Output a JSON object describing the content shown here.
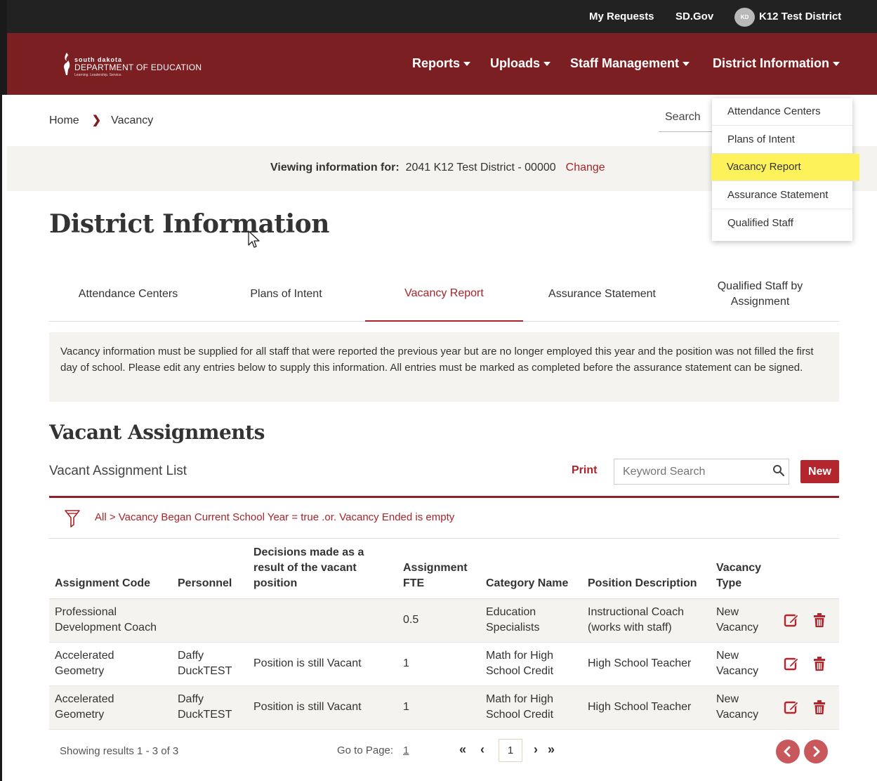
{
  "topbar": {
    "my_requests": "My Requests",
    "sd_gov": "SD.Gov",
    "avatar_initials": "KD",
    "user": "K12 Test District"
  },
  "logo": {
    "line1": "south dakota",
    "line2": "DEPARTMENT OF EDUCATION",
    "line3": "Learning. Leadership. Service."
  },
  "nav": {
    "items": [
      {
        "label": "Reports"
      },
      {
        "label": "Uploads"
      },
      {
        "label": "Staff Management"
      },
      {
        "label": "District Information"
      }
    ]
  },
  "breadcrumb": {
    "home": "Home",
    "current": "Vacancy"
  },
  "search_label": "Search",
  "viewing": {
    "label": "Viewing information for:",
    "value": "2041 K12 Test District - 00000",
    "change": "Change"
  },
  "dropdown": {
    "items": [
      {
        "label": "Attendance Centers"
      },
      {
        "label": "Plans of Intent"
      },
      {
        "label": "Vacancy Report"
      },
      {
        "label": "Assurance Statement"
      },
      {
        "label": "Qualified Staff"
      }
    ],
    "highlight_color": "#fef25b"
  },
  "page_title": "District Information",
  "tabs": [
    {
      "label": "Attendance Centers"
    },
    {
      "label": "Plans of Intent"
    },
    {
      "label": "Vacancy Report"
    },
    {
      "label": "Assurance Statement"
    },
    {
      "label": "Qualified Staff by Assignment"
    }
  ],
  "notice": "Vacancy information must be supplied for all staff that were reported the previous year but are no longer employed this year and the position was not filled the first day of school. Please edit any entries below to supply this information. All entries must be marked as completed before the assurance statement can be signed.",
  "section_title": "Vacant Assignments",
  "list": {
    "title": "Vacant Assignment List",
    "print": "Print",
    "keyword_placeholder": "Keyword Search",
    "new_button": "New"
  },
  "filter_text": "All > Vacancy Began Current School Year = true .or. Vacancy Ended is empty",
  "table": {
    "columns": [
      "Assignment Code",
      "Personnel",
      "Decisions made as a result of the vacant position",
      "Assignment FTE",
      "Category Name",
      "Position Description",
      "Vacancy Type"
    ],
    "rows": [
      [
        "Professional Development Coach",
        "",
        "",
        "0.5",
        "Education Specialists",
        "Instructional Coach (works with staff)",
        "New Vacancy"
      ],
      [
        "Accelerated Geometry",
        "Daffy DuckTEST",
        "Position is still Vacant",
        "1",
        "Math for High School Credit",
        "High School Teacher",
        "New Vacancy"
      ],
      [
        "Accelerated Geometry",
        "Daffy DuckTEST",
        "Position is still Vacant",
        "1",
        "Math for High School Credit",
        "High School Teacher",
        "New Vacancy"
      ]
    ]
  },
  "footer": {
    "showing": "Showing results 1 - 3 of 3",
    "goto_label": "Go to Page:",
    "goto_value": "1",
    "current_page": "1"
  },
  "colors": {
    "brand": "#7b1f23",
    "accent": "#a8242a",
    "topbar": "#222222"
  }
}
